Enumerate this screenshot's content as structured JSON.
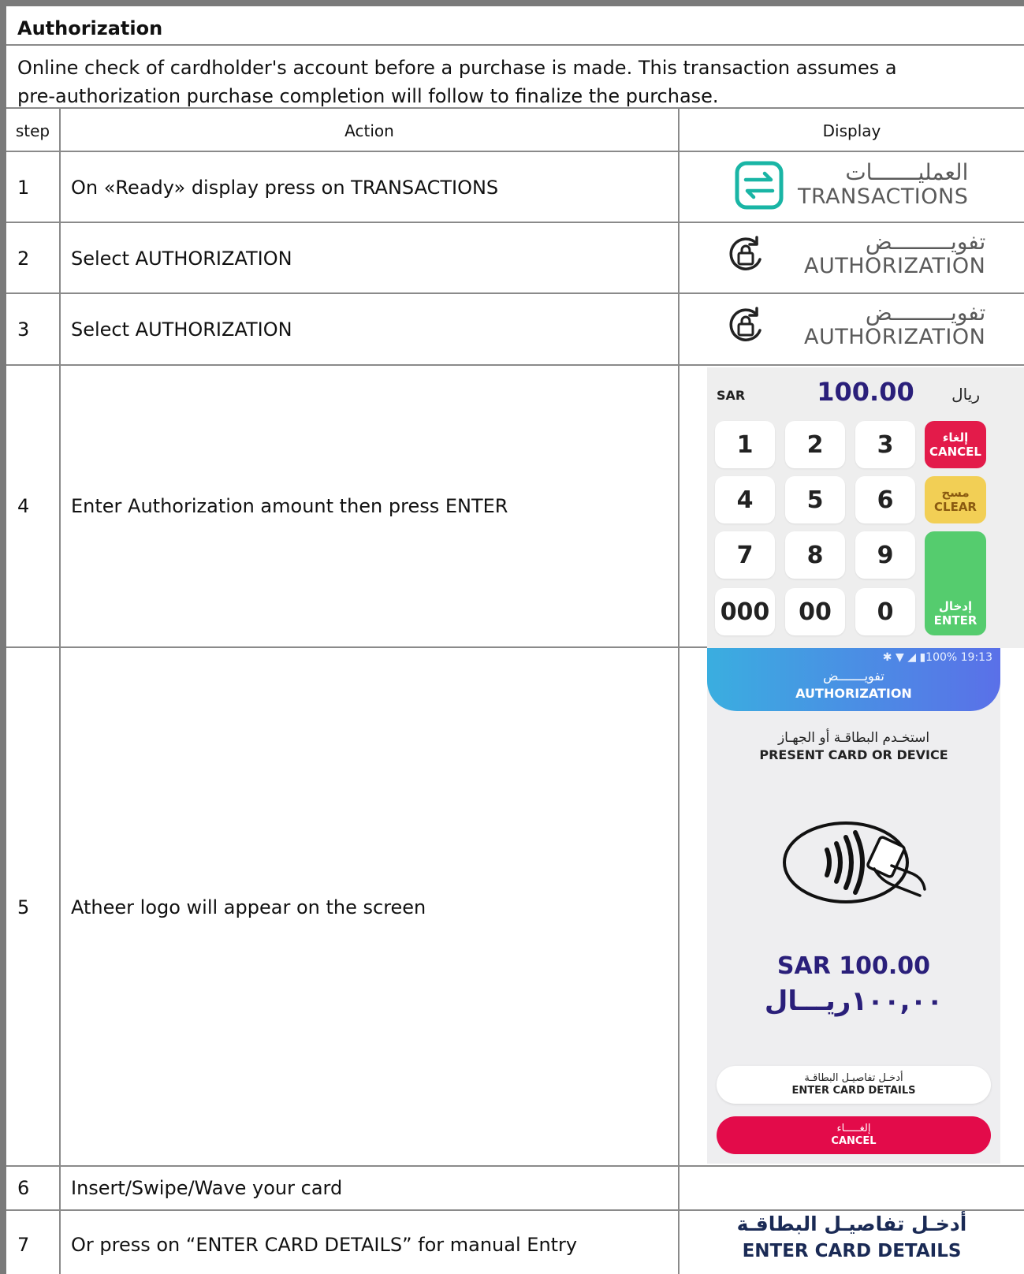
{
  "section": {
    "title": "Authorization",
    "description": "Online check of cardholder's account before a purchase is made. This transaction assumes a pre-authorization purchase completion will follow to finalize the purchase."
  },
  "table": {
    "headers": {
      "step": "step",
      "action": "Action",
      "display": "Display"
    },
    "rows": [
      {
        "step": "1",
        "action": "On «Ready» display press on TRANSACTIONS"
      },
      {
        "step": "2",
        "action": "Select AUTHORIZATION"
      },
      {
        "step": "3",
        "action": "Select AUTHORIZATION"
      },
      {
        "step": "4",
        "action": "Enter Authorization amount then press ENTER"
      },
      {
        "step": "5",
        "action": "Atheer logo will appear on the screen"
      },
      {
        "step": "6",
        "action": "Insert/Swipe/Wave your card"
      },
      {
        "step": "7",
        "action": "Or press on “ENTER CARD DETAILS” for manual Entry"
      }
    ]
  },
  "displays": {
    "transactions": {
      "ar": "العمليـــــــات",
      "en": "TRANSACTIONS",
      "color": "#19b5a5"
    },
    "authorization": {
      "ar": "تفويـــــــــض",
      "en": "AUTHORIZATION"
    },
    "keypad": {
      "currency": "SAR",
      "amount": "100.00",
      "currency_ar": "ريال",
      "keys": [
        "1",
        "2",
        "3",
        "4",
        "5",
        "6",
        "7",
        "8",
        "9",
        "000",
        "00",
        "0"
      ],
      "cancel_ar": "إلغاء",
      "cancel_en": "CANCEL",
      "clear_ar": "مسح",
      "clear_en": "CLEAR",
      "enter_ar": "إدخال",
      "enter_en": "ENTER",
      "colors": {
        "cancel": "#e31b4a",
        "clear": "#f2cf55",
        "enter": "#55cc6e"
      }
    },
    "phone": {
      "status": "100%  19:13",
      "title_ar": "تفويـــــــض",
      "title_en": "AUTHORIZATION",
      "present_ar": "استخـدم البطاقـة أو الجهـاز",
      "present_en": "PRESENT CARD OR DEVICE",
      "amount_en": "SAR 100.00",
      "amount_ar": "١٠٠,٠٠ريـــال",
      "enter_details_ar": "أدخـل تفاصيـل البطاقـة",
      "enter_details_en": "ENTER CARD DETAILS",
      "cancel_ar": "إلغـــــاء",
      "cancel_en": "CANCEL"
    },
    "row7": {
      "ar": "أدخـل تفاصيـل البطاقـة",
      "en": "ENTER CARD DETAILS"
    }
  }
}
